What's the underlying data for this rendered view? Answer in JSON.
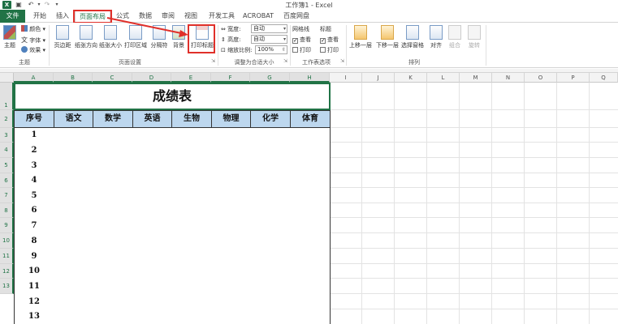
{
  "window": {
    "title": "工作簿1 - Excel",
    "logo": "X"
  },
  "quick_access": {
    "save_icon": "save-icon",
    "undo_icon": "undo-icon",
    "redo_icon": "redo-icon"
  },
  "tabs": {
    "file": "文件",
    "items": [
      "开始",
      "插入",
      "页面布局",
      "公式",
      "数据",
      "审阅",
      "视图",
      "开发工具",
      "ACROBAT",
      "百度网盘"
    ],
    "active_index": 2
  },
  "ribbon": {
    "theme_group": {
      "theme_label": "主题",
      "colors_label": "颜色",
      "fonts_label": "字体",
      "effects_label": "效果",
      "group_label": "主题"
    },
    "page_setup": {
      "margins": "页边距",
      "orientation": "纸张方向",
      "size": "纸张大小",
      "print_area": "打印区域",
      "breaks": "分隔符",
      "background": "背景",
      "print_titles": "打印标题",
      "group_label": "页面设置"
    },
    "scale_to_fit": {
      "width_label": "宽度:",
      "width_value": "自动",
      "height_label": "高度:",
      "height_value": "自动",
      "scale_label": "缩放比例:",
      "scale_value": "100%",
      "group_label": "调整为合适大小"
    },
    "sheet_options": {
      "gridlines_label": "网格线",
      "headings_label": "标题",
      "view_label": "查看",
      "print_label": "打印",
      "gridlines_view_checked": true,
      "headings_view_checked": true,
      "gridlines_print_checked": false,
      "headings_print_checked": false,
      "group_label": "工作表选项"
    },
    "arrange": {
      "bring_forward": "上移一层",
      "send_backward": "下移一层",
      "selection_pane": "选择窗格",
      "align": "对齐",
      "group": "组合",
      "rotate": "旋转",
      "group_label": "排列"
    }
  },
  "sheet": {
    "columns": [
      "A",
      "B",
      "C",
      "D",
      "E",
      "F",
      "G",
      "H",
      "I",
      "J",
      "K",
      "L",
      "M",
      "N",
      "O",
      "P",
      "Q"
    ],
    "rows": [
      "1",
      "2",
      "3",
      "4",
      "5",
      "6",
      "7",
      "8",
      "9",
      "10",
      "11",
      "12",
      "13"
    ],
    "title": "成绩表",
    "headers": [
      "序号",
      "语文",
      "数学",
      "英语",
      "生物",
      "物理",
      "化学",
      "体育"
    ],
    "serials": [
      "1",
      "2",
      "3",
      "4",
      "5",
      "6",
      "7",
      "8",
      "9",
      "10",
      "11",
      "12",
      "13"
    ]
  },
  "annotation_color": "#e0302a",
  "accent_color": "#217346",
  "header_fill": "#bdd7ee"
}
